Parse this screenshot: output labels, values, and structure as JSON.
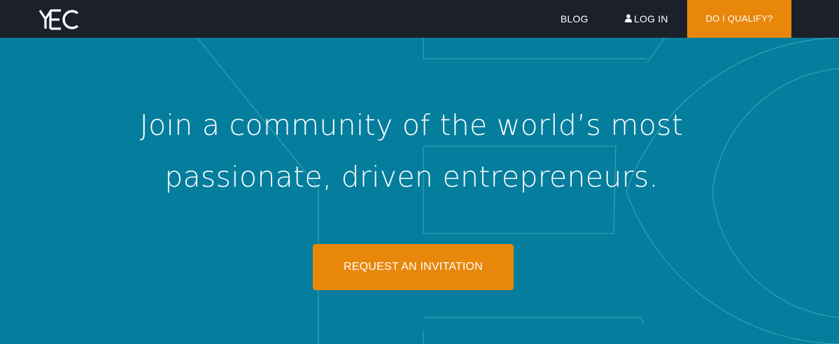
{
  "header": {
    "logo_text": "YEC",
    "nav": {
      "blog": "BLOG",
      "login": "LOG IN",
      "qualify": "DO I QUALIFY?"
    }
  },
  "hero": {
    "headline_line1": "Join a community of the world’s most",
    "headline_line2": "passionate, driven entrepreneurs.",
    "cta_label": "REQUEST AN INVITATION"
  },
  "colors": {
    "header_bg": "#1b202b",
    "hero_bg": "#057e9d",
    "accent": "#e8870a",
    "text": "#ffffff"
  },
  "icons": {
    "login": "user-icon",
    "logo": "yec-logo"
  }
}
